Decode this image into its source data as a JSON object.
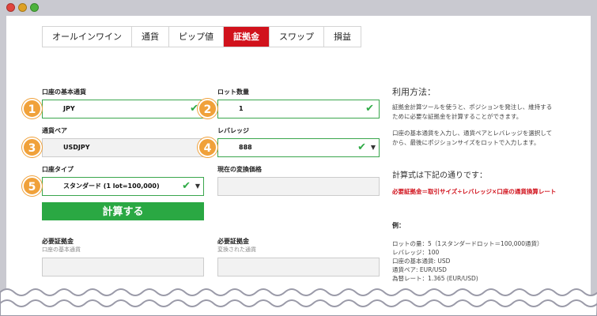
{
  "tabs": [
    "オールインワイン",
    "通貨",
    "ピップ値",
    "証拠金",
    "スワップ",
    "損益"
  ],
  "active_tab": "証拠金",
  "form": {
    "base_currency_label": "口座の基本通貨",
    "base_currency_value": "JPY",
    "lot_label": "ロット数量",
    "lot_value": "1",
    "pair_label": "通貨ペア",
    "pair_value": "USDJPY",
    "leverage_label": "レバレッジ",
    "leverage_value": "888",
    "account_type_label": "口座タイプ",
    "account_type_value": "スタンダード (1 lot=100,000)",
    "rate_label": "現在の変換価格",
    "calc_button": "計算する",
    "margin1_label": "必要証拠金",
    "margin1_sub": "口座の基本通貨",
    "margin2_label": "必要証拠金",
    "margin2_sub": "変換された通貨"
  },
  "badges": [
    "1",
    "2",
    "3",
    "4",
    "5"
  ],
  "side": {
    "usage_title": "利用方法：",
    "usage_p1": "証拠金計算ツールを使うと、ポジションを発注し、維持するために必要な証拠金を計算することができます。",
    "usage_p2": "口座の基本通貨を入力し、通貨ペアとレバレッジを選択してから、最後にポジションサイズをロットで入力します。",
    "formula_title": "計算式は下記の通りです：",
    "formula": "必要証拠金＝取引サイズ÷レバレッジ×口座の通貨換算レート",
    "example_title": "例：",
    "example_lines": [
      "ロットの量：5（1スタンダードロット＝100,000通貨）",
      "レバレッジ：100",
      "口座の基本通貨: USD",
      "通貨ペア: EUR/USD",
      "為替レート：1.365 (EUR/USD)"
    ]
  },
  "colors": {
    "accent_red": "#d1121c",
    "green": "#2aa843",
    "badge_orange": "#f0a13a"
  }
}
